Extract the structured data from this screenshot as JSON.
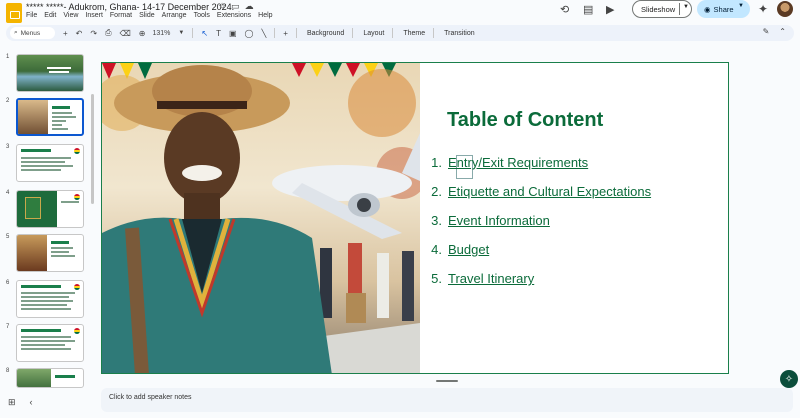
{
  "app": {
    "doc_title": "***** *****- Adukrom, Ghana- 14-17 December 2024.",
    "menu": [
      "File",
      "Edit",
      "View",
      "Insert",
      "Format",
      "Slide",
      "Arrange",
      "Tools",
      "Extensions",
      "Help"
    ]
  },
  "top_right": {
    "slideshow_label": "Slideshow",
    "share_label": "Share"
  },
  "toolbar": {
    "search_label": "Menus",
    "zoom": "131%",
    "background_label": "Background",
    "layout_label": "Layout",
    "theme_label": "Theme",
    "transition_label": "Transition"
  },
  "filmstrip": {
    "slides": [
      "1",
      "2",
      "3",
      "4",
      "5",
      "6",
      "7",
      "8"
    ],
    "active_slide": "2"
  },
  "slide": {
    "title": "Table of Content",
    "items": [
      {
        "num": "1.",
        "text": "Entry/Exit Requirements"
      },
      {
        "num": "2.",
        "text": "Etiquette and Cultural Expectations"
      },
      {
        "num": "3.",
        "text": "Event Information"
      },
      {
        "num": "4.",
        "text": "Budget"
      },
      {
        "num": "5.",
        "text": "Travel Itinerary"
      }
    ]
  },
  "notes": {
    "placeholder": "Click to add speaker notes"
  },
  "colors": {
    "accent_green": "#0b6b3a",
    "share_bg": "#c2e7ff",
    "selection_blue": "#0b57d0"
  }
}
